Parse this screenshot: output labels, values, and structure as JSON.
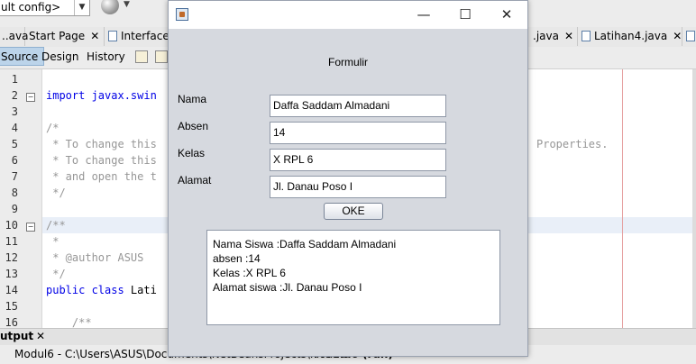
{
  "ide": {
    "config_combo": "ult config>",
    "tabs": [
      {
        "label": "..ava"
      },
      {
        "label": "Start Page"
      },
      {
        "label": "InterfaceB"
      },
      {
        "label": ".java"
      },
      {
        "label": "Latihan4.java"
      }
    ],
    "editor_modes": {
      "source": "Source",
      "design": "Design",
      "history": "History"
    },
    "line_numbers": [
      "1",
      "2",
      "3",
      "4",
      "5",
      "6",
      "7",
      "8",
      "9",
      "10",
      "11",
      "12",
      "13",
      "14",
      "15",
      "16"
    ],
    "code": {
      "l2": "import javax.swin",
      "l4": "/*",
      "l5": " * To change this",
      "l5_tail": "Properties.",
      "l6": " * To change this",
      "l7": " * and open the t",
      "l8": " */",
      "l10": "/**",
      "l11": " *",
      "l12": " * @author ASUS",
      "l13": " */",
      "l14_kw": "public class",
      "l14_rest": " Lati",
      "l16": "    /**"
    },
    "output_tab": "utput",
    "status": {
      "modul6": "Modul6 - C:\\Users\\ASUS\\Documents\\NetBeansProjects\\Modul6",
      "run_tab": "Modul6 (run)"
    }
  },
  "dialog": {
    "title_controls": {
      "minimize": "—",
      "maximize": "☐",
      "close": "✕"
    },
    "heading": "Formulir",
    "fields": [
      {
        "label": "Nama",
        "value": "Daffa Saddam Almadani"
      },
      {
        "label": "Absen",
        "value": "14"
      },
      {
        "label": "Kelas",
        "value": "X RPL 6"
      },
      {
        "label": "Alamat",
        "value": "Jl. Danau Poso I"
      }
    ],
    "button": "OKE",
    "result_lines": [
      "Nama Siswa :Daffa Saddam Almadani",
      "absen :14",
      "Kelas :X RPL 6",
      "Alamat siswa :Jl. Danau Poso I"
    ]
  }
}
